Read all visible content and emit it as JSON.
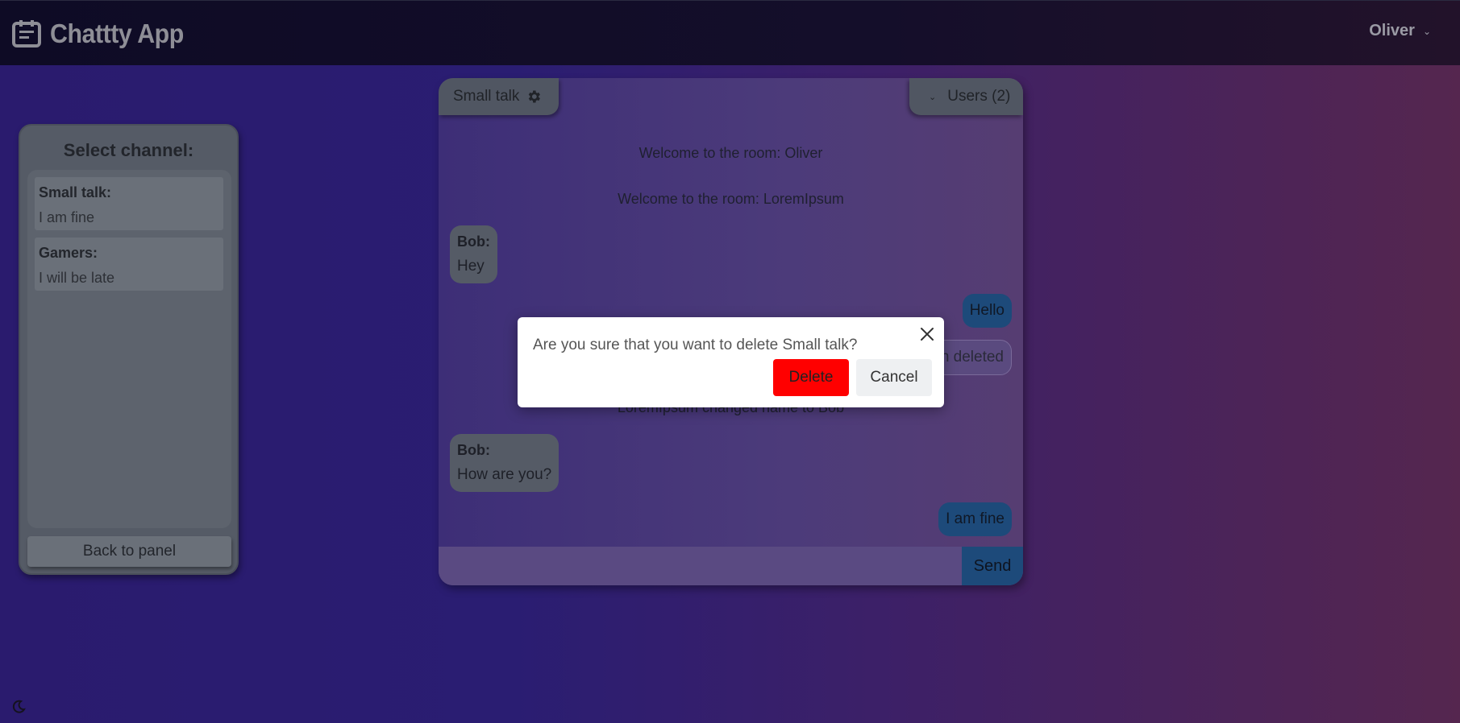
{
  "app": {
    "title": "Chattty App",
    "logo_icon": "calendar-note-icon",
    "user_name": "Oliver",
    "user_chevron": "⌄"
  },
  "channels": {
    "title": "Select channel:",
    "items": [
      {
        "name": "Small talk:",
        "last_message": "I am fine"
      },
      {
        "name": "Gamers:",
        "last_message": "I will be late"
      }
    ],
    "back_label": "Back to panel"
  },
  "chat": {
    "room_name": "Small talk",
    "users_label": "Users (2)",
    "users_chevron": "⌄",
    "system_messages": [
      "Welcome to the room: Oliver",
      "Welcome to the room: LoremIpsum",
      "LoremIpsum changed name to Bob"
    ],
    "messages": [
      {
        "sender": "Bob:",
        "text": "Hey"
      },
      {
        "text": "Hello"
      },
      {
        "text": "n deleted"
      },
      {
        "sender": "Bob:",
        "text": "How are you?"
      },
      {
        "text": "I am fine"
      }
    ],
    "input_placeholder": "",
    "send_label": "Send"
  },
  "modal": {
    "question": "Are you sure that you want to delete Small talk?",
    "delete_label": "Delete",
    "cancel_label": "Cancel"
  },
  "colors": {
    "delete_button": "#ff0000",
    "my_bubble": "#1d4a7a",
    "panel": "#555b66"
  }
}
